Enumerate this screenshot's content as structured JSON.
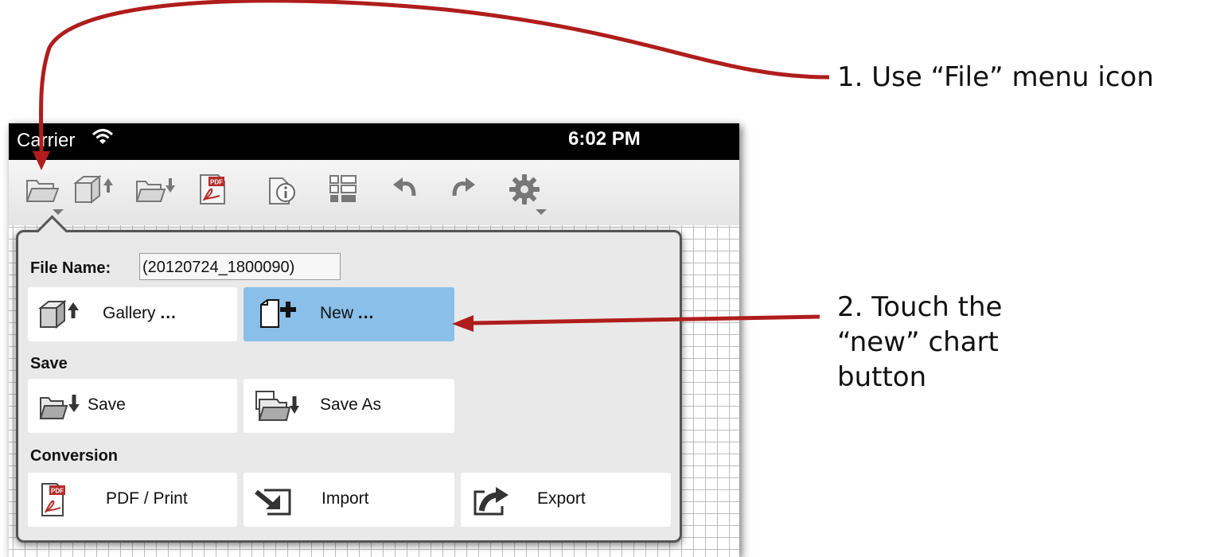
{
  "annotations": {
    "step1": "1. Use “File” menu icon",
    "step2": "2. Touch the “new” chart button"
  },
  "status_bar": {
    "carrier": "Carrier",
    "time": "6:02 PM"
  },
  "toolbar": {
    "icons": [
      "folder-open-icon",
      "gallery-upload-icon",
      "folder-save-icon",
      "pdf-icon",
      "info-icon",
      "list-icon",
      "undo-icon",
      "redo-icon",
      "gear-icon"
    ]
  },
  "file_menu": {
    "file_name_label": "File Name:",
    "file_name_value": "(20120724_1800090)",
    "gallery_label": "Gallery",
    "new_label": "New",
    "ellipsis": "...",
    "save_section": "Save",
    "save_label": "Save",
    "save_as_label": "Save As",
    "conversion_section": "Conversion",
    "pdf_label": "PDF / Print",
    "import_label": "Import",
    "export_label": "Export"
  },
  "colors": {
    "arrow": "#b01d1d",
    "selected_button": "#89bfe8"
  }
}
